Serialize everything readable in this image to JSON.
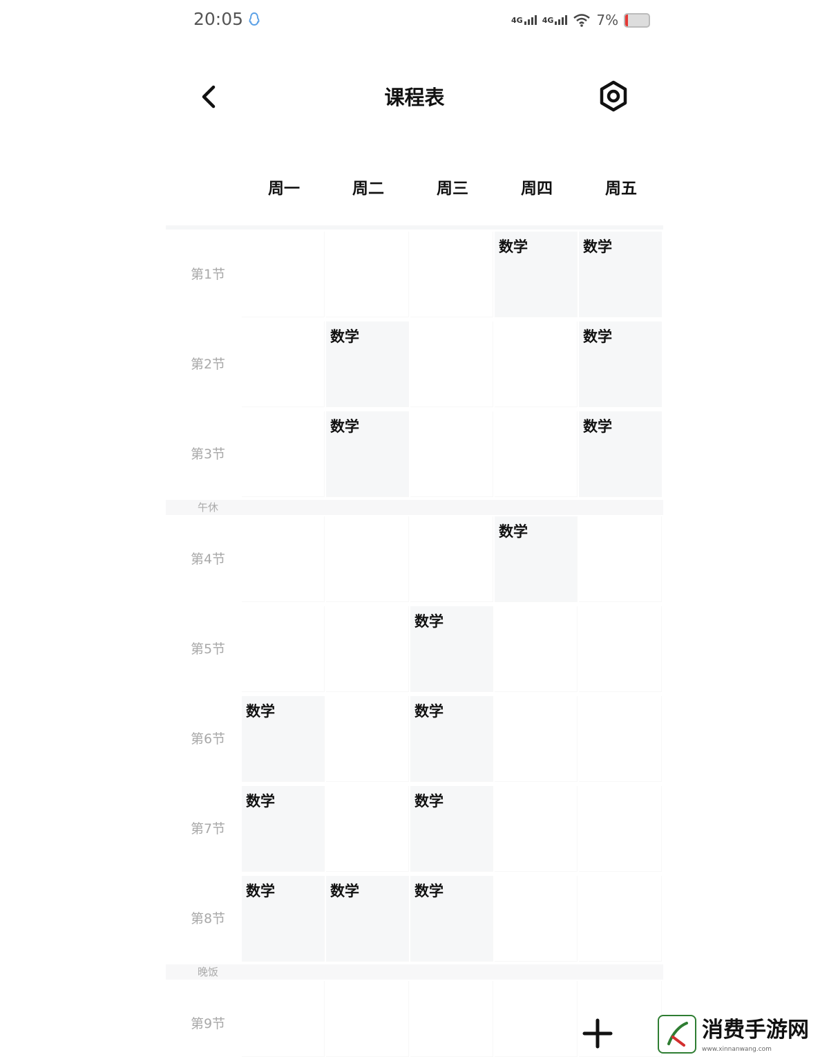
{
  "status_bar": {
    "time": "20:05",
    "network": [
      "4G",
      "4G"
    ],
    "battery_text": "7%",
    "battery_level": 0.07,
    "battery_low_color": "#e53935"
  },
  "header": {
    "title": "课程表",
    "back_icon": "chevron-left-icon",
    "settings_icon": "settings-gear-icon"
  },
  "days": [
    "周一",
    "周二",
    "周三",
    "周四",
    "周五"
  ],
  "periods": [
    "第1节",
    "第2节",
    "第3节",
    "第4节",
    "第5节",
    "第6节",
    "第7节",
    "第8节",
    "第9节"
  ],
  "breaks": {
    "lunch": "午休",
    "dinner": "晚饭"
  },
  "courses": {
    "mon": [
      "",
      "",
      "",
      "",
      "",
      "数学",
      "数学",
      "数学",
      ""
    ],
    "tue": [
      "",
      "数学",
      "数学",
      "",
      "",
      "",
      "",
      "数学",
      ""
    ],
    "wed": [
      "",
      "",
      "",
      "",
      "数学",
      "数学",
      "数学",
      "数学",
      ""
    ],
    "thu": [
      "数学",
      "",
      "",
      "数学",
      "",
      "",
      "",
      "",
      ""
    ],
    "fri": [
      "数学",
      "数学",
      "数学",
      "",
      "",
      "",
      "",
      "",
      ""
    ]
  },
  "fab": {
    "icon": "plus-icon"
  },
  "watermark": {
    "text": "消费手游网",
    "url": "www.xinnanwang.com"
  },
  "colors": {
    "course_bg": "#f6f7f8",
    "period_text": "#a8a8a8"
  }
}
